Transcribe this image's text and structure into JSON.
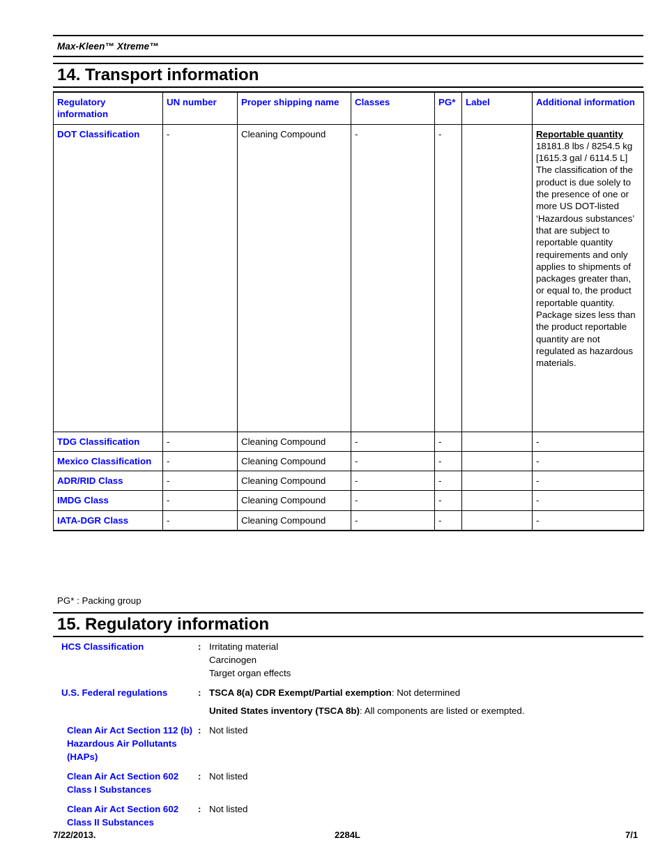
{
  "header": {
    "product_name": "Max-Kleen™ Xtreme™"
  },
  "section14": {
    "title": "14. Transport information",
    "columns": [
      "Regulatory information",
      "UN number",
      "Proper shipping name",
      "Classes",
      "PG*",
      "Label",
      "Additional information"
    ],
    "rows": [
      {
        "regulatory_information": "DOT Classification",
        "un_number": "-",
        "proper_shipping_name": "Cleaning Compound",
        "classes": "-",
        "pg": "-",
        "label": "",
        "additional_information_title": "Reportable quantity",
        "additional_information": "18181.8 lbs / 8254.5 kg [1615.3 gal / 6114.5 L]\nThe classification of the product is due solely to the presence of one or more US DOT-listed ‘Hazardous substances’ that are subject to reportable quantity requirements and only applies to shipments of packages greater than, or equal to, the product reportable quantity.  Package sizes less than the product reportable quantity are not regulated as hazardous materials."
      },
      {
        "regulatory_information": "TDG Classification",
        "un_number": "-",
        "proper_shipping_name": "Cleaning Compound",
        "classes": "-",
        "pg": "-",
        "label": "",
        "additional_information_title": "",
        "additional_information": "-"
      },
      {
        "regulatory_information": "Mexico Classification",
        "un_number": "-",
        "proper_shipping_name": "Cleaning Compound",
        "classes": "-",
        "pg": "-",
        "label": "",
        "additional_information_title": "",
        "additional_information": "-"
      },
      {
        "regulatory_information": "ADR/RID Class",
        "un_number": "-",
        "proper_shipping_name": "Cleaning Compound",
        "classes": "-",
        "pg": "-",
        "label": "",
        "additional_information_title": "",
        "additional_information": "-"
      },
      {
        "regulatory_information": "IMDG Class",
        "un_number": "-",
        "proper_shipping_name": "Cleaning Compound",
        "classes": "-",
        "pg": "-",
        "label": "",
        "additional_information_title": "",
        "additional_information": "-"
      },
      {
        "regulatory_information": "IATA-DGR Class",
        "un_number": "-",
        "proper_shipping_name": "Cleaning Compound",
        "classes": "-",
        "pg": "-",
        "label": "",
        "additional_information_title": "",
        "additional_information": "-"
      }
    ],
    "footnote": "PG* : Packing group"
  },
  "section15": {
    "title": "15. Regulatory information",
    "rows": [
      {
        "label": "HCS Classification",
        "colon": ":",
        "values": [
          {
            "bold": "",
            "text": "Irritating material"
          },
          {
            "bold": "",
            "text": "Carcinogen"
          },
          {
            "bold": "",
            "text": "Target organ effects"
          }
        ]
      },
      {
        "label": "U.S. Federal regulations",
        "colon": ":",
        "values": [
          {
            "bold": "TSCA 8(a) CDR Exempt/Partial exemption",
            "text": ": Not determined"
          },
          {
            "bold": "United States inventory (TSCA 8b)",
            "text": ": All components are listed or exempted."
          }
        ]
      },
      {
        "label": "Clean Air Act  Section 112 (b) Hazardous Air Pollutants (HAPs)",
        "colon": ":",
        "values": [
          {
            "bold": "",
            "text": "Not listed"
          }
        ]
      },
      {
        "label": "Clean Air Act Section 602 Class I Substances",
        "colon": ":",
        "values": [
          {
            "bold": "",
            "text": "Not listed"
          }
        ]
      },
      {
        "label": "Clean Air Act Section 602 Class II Substances",
        "colon": ":",
        "values": [
          {
            "bold": "",
            "text": "Not listed"
          }
        ]
      }
    ]
  },
  "footer": {
    "date": "7/22/2013.",
    "document_code": "2284L",
    "page": "7/1"
  },
  "colors": {
    "heading_blue": "#0000ff",
    "text_black": "#000000",
    "page_background": "#ffffff"
  }
}
